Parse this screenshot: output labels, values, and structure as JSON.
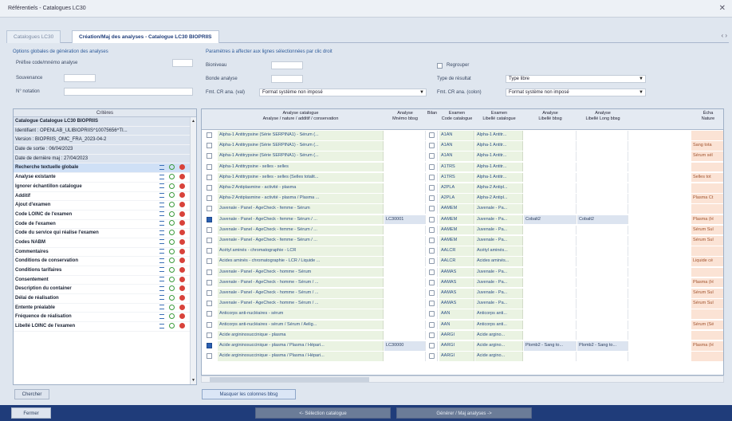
{
  "window": {
    "title": "Référentiels - Catalogues LC30",
    "close_icon": "close-icon"
  },
  "tabs": [
    "Catalogues LC30",
    "Création/Maj des analyses - Catalogue LC30 BIOPRIIS"
  ],
  "options": {
    "header": "Options globales de génération des analyses",
    "profil_label": "Préfixe code/mnémo analyse",
    "souvenance_label": "Souvenance",
    "n_notation_label": "N° notation"
  },
  "params": {
    "header": "Paramètres à affecter aux lignes sélectionnées par clic droit",
    "bioeniveau_label": "Bioniveau",
    "bonde_label": "Bonde analyse",
    "fmt_valeur_label": "Fmt. CR ana. (val)",
    "fmt_valeur_value": "Format système non imposé",
    "regrouper_label": "Regrouper",
    "type_resultat_label": "Type de résultat",
    "type_resultat_value": "Type libre",
    "fmt_colonnes_label": "Fmt. CR ana. (colon)",
    "fmt_colonnes_value": "Format système non imposé"
  },
  "criteria": {
    "header": "Critères",
    "items": [
      {
        "label": "Catalogue Catalogue LC30 BIOPRIIS",
        "bold": true,
        "info": true,
        "acts": false
      },
      {
        "label": "Identifiant : OPENLAB_ULIBIOPRIIS^10075656^TI...",
        "bold": false,
        "info": true,
        "acts": false
      },
      {
        "label": "Version : BIOPRIIS_OMC_FRA_2023-04-2",
        "bold": false,
        "info": true,
        "acts": false
      },
      {
        "label": "Date de sortie : 06/04/2023",
        "bold": false,
        "info": true,
        "acts": false
      },
      {
        "label": "Date de dernière maj : 27/04/2023",
        "bold": false,
        "info": true,
        "acts": false
      },
      {
        "label": "Recherche textuelle globale",
        "bold": true,
        "selected": true,
        "acts": true
      },
      {
        "label": "Analyse existante",
        "bold": true,
        "acts": true
      },
      {
        "label": "Ignorer échantillon catalogue",
        "bold": true,
        "acts": true
      },
      {
        "label": "Additif",
        "bold": true,
        "acts": true
      },
      {
        "label": "Ajout d'examen",
        "bold": true,
        "acts": true
      },
      {
        "label": "Code LOINC de l'examen",
        "bold": true,
        "acts": true
      },
      {
        "label": "Code de l'examen",
        "bold": true,
        "acts": true
      },
      {
        "label": "Code du service qui réalise l'examen",
        "bold": true,
        "acts": true
      },
      {
        "label": "Codes NABM",
        "bold": true,
        "acts": true
      },
      {
        "label": "Commentaires",
        "bold": true,
        "acts": true
      },
      {
        "label": "Conditions de conservation",
        "bold": true,
        "acts": true
      },
      {
        "label": "Conditions tarifaires",
        "bold": true,
        "acts": true
      },
      {
        "label": "Consentement",
        "bold": true,
        "acts": true
      },
      {
        "label": "Description du container",
        "bold": true,
        "acts": true
      },
      {
        "label": "Délai de réalisation",
        "bold": true,
        "acts": true
      },
      {
        "label": "Entente préalable",
        "bold": true,
        "acts": true
      },
      {
        "label": "Fréquence de réalisation",
        "bold": true,
        "acts": true
      },
      {
        "label": "Libellé LOINC de l'examen",
        "bold": true,
        "acts": true
      }
    ]
  },
  "grid": {
    "headers": {
      "libelle": "Analyse catalogue\nAnalyse / nature / additif / conservation",
      "min": "Analyse\nMnémo bbsg",
      "bil": "Bilan",
      "code": "Examen\nCode catalogue",
      "libcat": "Examen\nLibellé catalogue",
      "abib": "Analyse\nLibellé bbsg",
      "albib": "Analyse\nLibellé Long bbsg",
      "ech": "Écha\nNature"
    },
    "rows": [
      {
        "lib": "Alpha-1 Antitrypsine (Série SERPINA1) - Sérum (...",
        "min": "",
        "code": "A1AN",
        "libcat": "Alpha-1 Antitr...",
        "abib": "",
        "albib": "",
        "ech": "",
        "on": false
      },
      {
        "lib": "Alpha-1 Antitrypsine (Série SERPINA1) - Sérum (...",
        "min": "",
        "code": "A1AN",
        "libcat": "Alpha-1 Antitr...",
        "abib": "",
        "albib": "",
        "ech": "Sang tota",
        "on": false
      },
      {
        "lib": "Alpha-1 Antitrypsine (Série SERPINA1) - Sérum (...",
        "min": "",
        "code": "A1AN",
        "libcat": "Alpha-1 Antitr...",
        "abib": "",
        "albib": "",
        "ech": "Sérum sél",
        "on": false
      },
      {
        "lib": "Alpha-1 Antitrypsine - selles - selles",
        "min": "",
        "code": "A1TRS",
        "libcat": "Alpha-1 Antitr...",
        "abib": "",
        "albib": "",
        "ech": "",
        "on": false
      },
      {
        "lib": "Alpha-1 Antitrypsine - selles - selles (Selles totalit...",
        "min": "",
        "code": "A1TRS",
        "libcat": "Alpha-1 Antitr...",
        "abib": "",
        "albib": "",
        "ech": "Selles tot",
        "on": false
      },
      {
        "lib": "Alpha-2 Antiplasmine - activité - plasma",
        "min": "",
        "code": "A2PLA",
        "libcat": "Alpha-2 Antipl...",
        "abib": "",
        "albib": "",
        "ech": "",
        "on": false
      },
      {
        "lib": "Alpha-2 Antiplasmine - activité - plasma / Plasma ...",
        "min": "",
        "code": "A2PLA",
        "libcat": "Alpha-2 Antipl...",
        "abib": "",
        "albib": "",
        "ech": "Plasma Ct",
        "on": false
      },
      {
        "lib": "Juvenale - Panel - AgeCheck - femme - Sérum",
        "min": "",
        "code": "AAMEM",
        "libcat": "Juvenale - Pa...",
        "abib": "",
        "albib": "",
        "ech": "",
        "on": false
      },
      {
        "lib": "Juvenale - Panel - AgeCheck - femme - Sérum / ...",
        "min": "LC30001",
        "code": "AAMEM",
        "libcat": "Juvenale - Pa...",
        "abib": "Cobalt2",
        "albib": "Cobalt2",
        "ech": "Plasma (H",
        "on": true
      },
      {
        "lib": "Juvenale - Panel - AgeCheck - femme - Sérum / ...",
        "min": "",
        "code": "AAMEM",
        "libcat": "Juvenale - Pa...",
        "abib": "",
        "albib": "",
        "ech": "Sérum Sul",
        "on": false
      },
      {
        "lib": "Juvenale - Panel - AgeCheck - femme - Sérum / ...",
        "min": "",
        "code": "AAMEM",
        "libcat": "Juvenale - Pa...",
        "abib": "",
        "albib": "",
        "ech": "Sérum Sul",
        "on": false
      },
      {
        "lib": "Acétyl aminés - chromatographie - LCR",
        "min": "",
        "code": "AALCR",
        "libcat": "Acétyl aminés...",
        "abib": "",
        "albib": "",
        "ech": "",
        "on": false
      },
      {
        "lib": "Acides aminés - chromatographie - LCR / Liquide ...",
        "min": "",
        "code": "AALCR",
        "libcat": "Acides aminés...",
        "abib": "",
        "albib": "",
        "ech": "Liquide cé",
        "on": false
      },
      {
        "lib": "Juvenale - Panel - AgeCheck - homme - Sérum",
        "min": "",
        "code": "AAMAS",
        "libcat": "Juvenale - Pa...",
        "abib": "",
        "albib": "",
        "ech": "",
        "on": false
      },
      {
        "lib": "Juvenale - Panel - AgeCheck - homme - Sérum / ...",
        "min": "",
        "code": "AAMAS",
        "libcat": "Juvenale - Pa...",
        "abib": "",
        "albib": "",
        "ech": "Plasma (H",
        "on": false
      },
      {
        "lib": "Juvenale - Panel - AgeCheck - homme - Sérum / ...",
        "min": "",
        "code": "AAMAS",
        "libcat": "Juvenale - Pa...",
        "abib": "",
        "albib": "",
        "ech": "Sérum Sul",
        "on": false
      },
      {
        "lib": "Juvenale - Panel - AgeCheck - homme - Sérum / ...",
        "min": "",
        "code": "AAMAS",
        "libcat": "Juvenale - Pa...",
        "abib": "",
        "albib": "",
        "ech": "Sérum Sul",
        "on": false
      },
      {
        "lib": "Anticorps anti-nucléaires - sérum",
        "min": "",
        "code": "AAN",
        "libcat": "Anticorps anti...",
        "abib": "",
        "albib": "",
        "ech": "",
        "on": false
      },
      {
        "lib": "Anticorps anti-nucléaires - sérum / Sérum / Aelig...",
        "min": "",
        "code": "AAN",
        "libcat": "Anticorps anti...",
        "abib": "",
        "albib": "",
        "ech": "Sérum (Sé",
        "on": false
      },
      {
        "lib": "Acide argininosuccinique - plasma",
        "min": "",
        "code": "AARGI",
        "libcat": "Acide argino...",
        "abib": "",
        "albib": "",
        "ech": "",
        "on": false
      },
      {
        "lib": "Acide argininosuccinique - plasma / Plasma / Hépari...",
        "min": "LC30000",
        "code": "AARGI",
        "libcat": "Acide argino...",
        "abib": "Plomb2 - Sang to...",
        "albib": "Plomb2 - Sang to...",
        "ech": "Plasma (H",
        "on": true
      },
      {
        "lib": "Acide argininosuccinique - plasma / Plasma / Hépari...",
        "min": "",
        "code": "AARGI",
        "libcat": "Acide argino...",
        "abib": "",
        "albib": "",
        "ech": "",
        "on": false
      }
    ]
  },
  "buttons": {
    "chercher": "Chercher",
    "masquer": "Masquer les colonnes bbsg",
    "fermer": "Fermer",
    "selection": "<- Sélection catalogue",
    "generer": "Générer / Maj analyses ->"
  }
}
